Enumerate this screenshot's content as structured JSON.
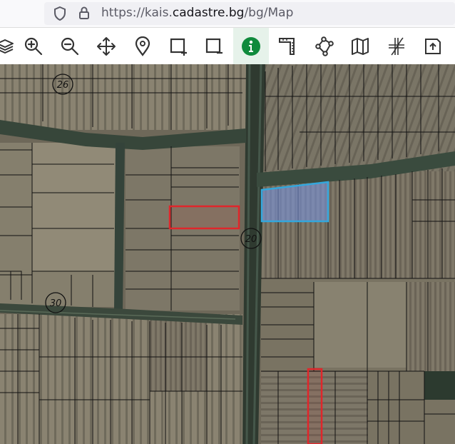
{
  "browser": {
    "url_prefix": "https://kais.",
    "url_domain": "cadastre.bg",
    "url_suffix": "/bg/Map"
  },
  "toolbar": {
    "tools": [
      {
        "name": "layers-icon"
      },
      {
        "name": "zoom-in-icon"
      },
      {
        "name": "zoom-out-icon"
      },
      {
        "name": "pan-icon"
      },
      {
        "name": "location-pin-icon"
      },
      {
        "name": "select-add-icon"
      },
      {
        "name": "select-remove-icon"
      },
      {
        "name": "info-icon",
        "active": true
      },
      {
        "name": "measure-ruler-icon"
      },
      {
        "name": "polygon-icon"
      },
      {
        "name": "map-icon"
      },
      {
        "name": "coordinates-icon"
      },
      {
        "name": "export-icon"
      }
    ],
    "active_color": "#0f8a3c"
  },
  "map": {
    "road_labels": [
      "26",
      "20",
      "30"
    ],
    "highlight_red": "#e0262b",
    "highlight_blue": "#33a7dc"
  }
}
